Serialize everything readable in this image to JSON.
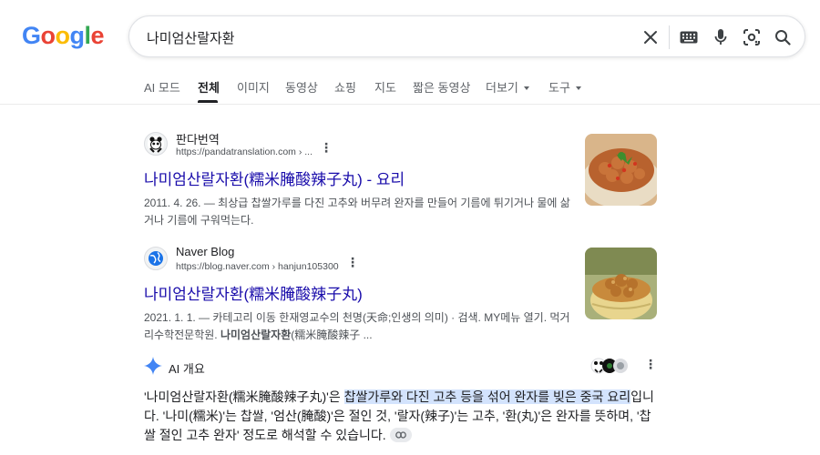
{
  "logo": {
    "letters": [
      "G",
      "o",
      "o",
      "g",
      "l",
      "e"
    ],
    "colors": [
      "#4285f4",
      "#ea4335",
      "#fbbc05",
      "#4285f4",
      "#34a853",
      "#ea4335"
    ]
  },
  "search": {
    "query": "나미엄산랄자환"
  },
  "tabs": [
    {
      "label": "AI 모드"
    },
    {
      "label": "전체",
      "active": true
    },
    {
      "label": "이미지"
    },
    {
      "label": "동영상"
    },
    {
      "label": "쇼핑"
    },
    {
      "label": "지도"
    },
    {
      "label": "짧은 동영상"
    },
    {
      "label": "더보기"
    },
    {
      "label": "도구"
    }
  ],
  "results": [
    {
      "site_name": "판다번역",
      "url": "https://pandatranslation.com › ...",
      "title": "나미엄산랄자환(糯米腌酸辣子丸) - 요리",
      "date": "2011. 4. 26.",
      "snippet": " — 최상급 찹쌀가루를 다진 고추와 버무려 완자를 만들어 기름에 튀기거나 물에 삶거나 기름에 구워먹는다."
    },
    {
      "site_name": "Naver Blog",
      "url": "https://blog.naver.com › hanjun105300",
      "title": "나미엄산랄자환(糯米腌酸辣子丸)",
      "date": "2021. 1. 1.",
      "snippet_pre": " — 카테고리 이동 한재영교수의 천명(天命;인생의 의미) · 검색. MY메뉴 열기. 먹거리수학전문학원. ",
      "snippet_bold": "나미엄산랄자환",
      "snippet_post": "(糯米腌酸辣子 ..."
    }
  ],
  "ai_overview": {
    "title": "AI 개요",
    "body_pre": "'나미엄산랄자환(糯米腌酸辣子丸)'은 ",
    "body_highlight": "찹쌀가루와 다진 고추 등을 섞어 완자를 빚은 중국 요리",
    "body_post": "입니다. '나미(糯米)'는 찹쌀, '엄산(腌酸)'은 절인 것, '랄자(辣子)'는 고추, '환(丸)'은 완자를 뜻하며, '찹쌀 절인 고추 완자' 정도로 해석할 수 있습니다."
  },
  "icons": {
    "clear": "close-icon",
    "keyboard": "keyboard-icon",
    "mic": "mic-icon",
    "lens": "lens-icon",
    "search": "search-icon",
    "ai": "sparkle-icon",
    "link": "link-icon"
  },
  "colors": {
    "link": "#1a0dab",
    "ai_highlight": "#d3e3fd",
    "ai_star": "#4285f4"
  }
}
